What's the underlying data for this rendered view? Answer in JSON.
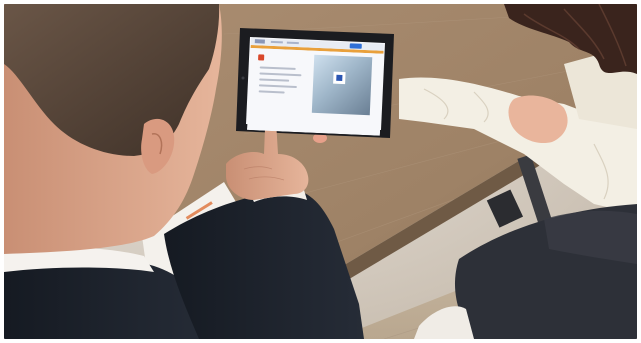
{
  "scene": {
    "colors": {
      "table": "#9e8266",
      "table_edge": "#6f5a45",
      "suit": "#1d222b",
      "shirt_cuff": "#f3efe9",
      "hair_man": "#5a463a",
      "skin": "#e7b49a",
      "blouse": "#f3efe4",
      "jeans": "#2d3038",
      "tablet_bezel": "#1b1c20",
      "screen_bg": "#f7f8fb",
      "screen_accent": "#e9a03b",
      "screen_button": "#2f6fd6",
      "brochure": "#f4f1ec",
      "brochure_accent": "#e07a45"
    },
    "icons": [
      "tablet-icon",
      "brochure-icon"
    ]
  }
}
